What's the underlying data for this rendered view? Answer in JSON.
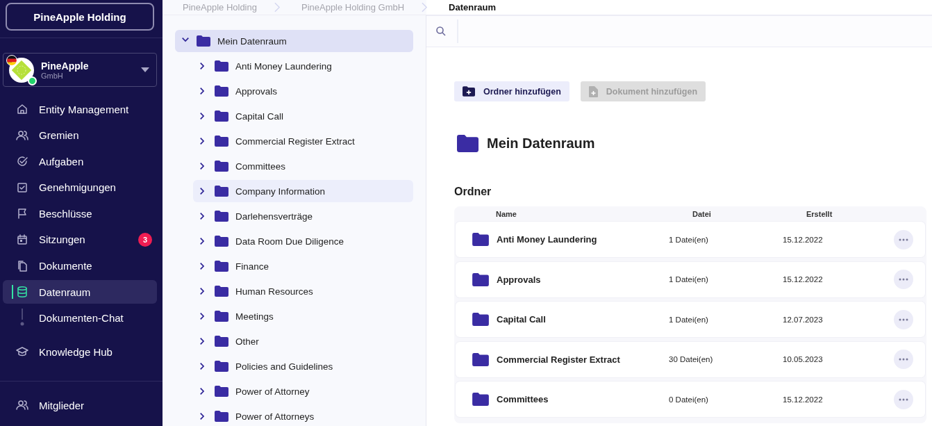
{
  "sidebar": {
    "workspace_button": "PineApple Holding",
    "entity": {
      "name": "PineApple",
      "type": "GmbH"
    },
    "nav": [
      {
        "label": "Entity Management",
        "kind": "item",
        "selected": false
      },
      {
        "label": "Gremien",
        "kind": "item",
        "selected": false
      },
      {
        "label": "Aufgaben",
        "kind": "item",
        "selected": false
      },
      {
        "label": "Genehmigungen",
        "kind": "item",
        "selected": false
      },
      {
        "label": "Beschlüsse",
        "kind": "item",
        "selected": false
      },
      {
        "label": "Sitzungen",
        "kind": "item",
        "selected": false,
        "badge": "3"
      },
      {
        "label": "Dokumente",
        "kind": "item",
        "selected": false
      },
      {
        "label": "Datenraum",
        "kind": "item",
        "selected": true
      },
      {
        "label": "Dokumenten-Chat",
        "kind": "sub",
        "selected": false
      }
    ],
    "secondary": [
      {
        "label": "Knowledge Hub",
        "kind": "item",
        "selected": false
      }
    ],
    "footer": [
      {
        "label": "Mitglieder",
        "kind": "item",
        "selected": false
      }
    ]
  },
  "breadcrumb": [
    "PineApple Holding",
    "PineApple Holding GmbH",
    "Datenraum"
  ],
  "tree": [
    {
      "label": "Mein Datenraum",
      "expanded": true,
      "selected": true,
      "children": [
        {
          "label": "Anti Money Laundering",
          "expanded": false,
          "selected": false
        },
        {
          "label": "Approvals",
          "expanded": false,
          "selected": false
        },
        {
          "label": "Capital Call",
          "expanded": false,
          "selected": false
        },
        {
          "label": "Commercial Register Extract",
          "expanded": false,
          "selected": false
        },
        {
          "label": "Committees",
          "expanded": false,
          "selected": false
        },
        {
          "label": "Company Information",
          "expanded": false,
          "selected": false,
          "hovered": true
        },
        {
          "label": "Darlehensverträge",
          "expanded": false,
          "selected": false
        },
        {
          "label": "Data Room Due Diligence",
          "expanded": false,
          "selected": false
        },
        {
          "label": "Finance",
          "expanded": false,
          "selected": false
        },
        {
          "label": "Human Resources",
          "expanded": false,
          "selected": false
        },
        {
          "label": "Meetings",
          "expanded": false,
          "selected": false
        },
        {
          "label": "Other",
          "expanded": false,
          "selected": false
        },
        {
          "label": "Policies and Guidelines",
          "expanded": false,
          "selected": false
        },
        {
          "label": "Power of Attorney",
          "expanded": false,
          "selected": false
        },
        {
          "label": "Power of Attorneys",
          "expanded": false,
          "selected": false
        }
      ]
    }
  ],
  "main": {
    "actions": [
      {
        "label": "Ordner hinzufügen",
        "kind": "folder",
        "disabled": false
      },
      {
        "label": "Dokument hinzufügen",
        "kind": "document",
        "disabled": true
      }
    ],
    "title": "Mein Datenraum",
    "section": "Ordner",
    "table": {
      "columns": [
        "Name",
        "Datei",
        "Erstellt"
      ],
      "rows": [
        {
          "name": "Anti Money Laundering",
          "files": "1 Datei(en)",
          "created": "15.12.2022"
        },
        {
          "name": "Approvals",
          "files": "1 Datei(en)",
          "created": "15.12.2022"
        },
        {
          "name": "Capital Call",
          "files": "1 Datei(en)",
          "created": "12.07.2023"
        },
        {
          "name": "Commercial Register Extract",
          "files": "30 Datei(en)",
          "created": "10.05.2023"
        },
        {
          "name": "Committees",
          "files": "0 Datei(en)",
          "created": "15.12.2022"
        }
      ]
    }
  }
}
